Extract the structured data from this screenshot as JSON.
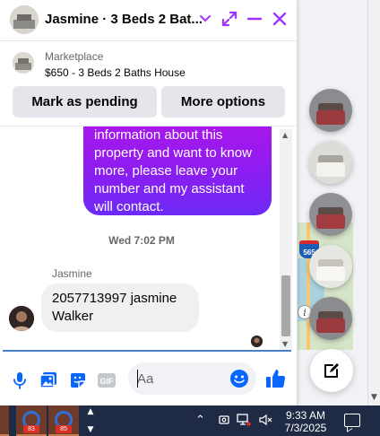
{
  "chat": {
    "title": "Jasmine · 3 Beds 2 Bat...",
    "accent": "#a033ff",
    "marketplace_label": "Marketplace",
    "listing": "$650 - 3 Beds 2 Baths House",
    "mark_pending": "Mark as pending",
    "more_options": "More options"
  },
  "messages": {
    "outgoing_text": "information about this property and want to know more, please leave your number and my assistant will contact.",
    "timestamp": "Wed 7:02 PM",
    "incoming_sender": "Jasmine",
    "incoming_text": "2057713997 jasmine Walker"
  },
  "composer": {
    "placeholder": "Aa",
    "icons": [
      "microphone-icon",
      "photo-icon",
      "sticker-icon",
      "gif-icon",
      "emoji-icon",
      "like-icon"
    ]
  },
  "map": {
    "route_number": "565"
  },
  "taskbar": {
    "badges": [
      "83",
      "85"
    ],
    "time": "9:33 AM",
    "date": "7/3/2025"
  }
}
